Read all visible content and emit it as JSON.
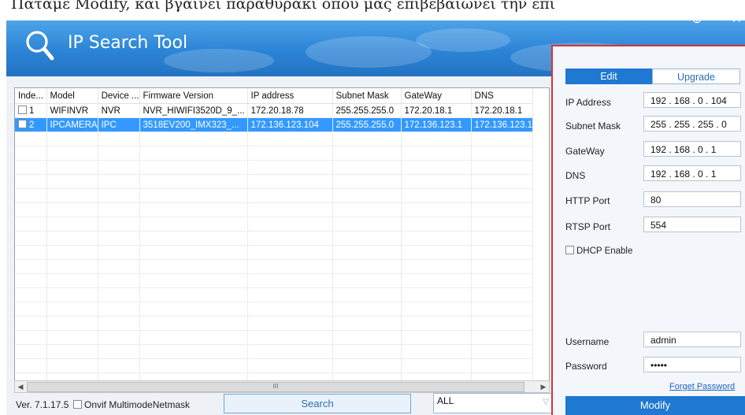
{
  "caption": "Πατάμε Modify, και βγαίνει παράθυράκι όπου μας επιβεβαιώνει την επι",
  "app": {
    "title": "IP Search Tool",
    "window_controls": {
      "add": "⊕",
      "minimize": "–",
      "close": "✕"
    }
  },
  "table": {
    "columns": [
      "Inde...",
      "Model",
      "Device ...",
      "Firmware Version",
      "IP address",
      "Subnet Mask",
      "GateWay",
      "DNS"
    ],
    "rows": [
      {
        "index": "1",
        "model": "WIFINVR",
        "device": "NVR",
        "firmware": "NVR_HIWIFI3520D_9_...",
        "ip": "172.20.18.78",
        "mask": "255.255.255.0",
        "gateway": "172.20.18.1",
        "dns": "172.20.18.1",
        "selected": false
      },
      {
        "index": "2",
        "model": "IPCAMERA",
        "device": "IPC",
        "firmware": "3518EV200_IMX323_...",
        "ip": "172.136.123.104",
        "mask": "255.255.255.0",
        "gateway": "172.136.123.1",
        "dns": "172.136.123.1",
        "selected": true
      }
    ],
    "scrollbar_thumb": "III"
  },
  "bottom": {
    "version": "Ver. 7.1.17.5",
    "onvif_label": "Onvif MultimodeNetmask",
    "search_label": "Search",
    "filter_value": "ALL"
  },
  "panel": {
    "tabs": {
      "edit": "Edit",
      "upgrade": "Upgrade"
    },
    "fields": {
      "ip_label": "IP Address",
      "ip_value": "192 . 168 .  0  . 104",
      "mask_label": "Subnet Mask",
      "mask_value": "255 . 255 . 255 .  0",
      "gateway_label": "GateWay",
      "gateway_value": "192 . 168 .  0  .  1",
      "dns_label": "DNS",
      "dns_value": "192 . 168 .  0  .  1",
      "http_label": "HTTP Port",
      "http_value": "80",
      "rtsp_label": "RTSP Port",
      "rtsp_value": "554",
      "dhcp_label": "DHCP Enable",
      "username_label": "Username",
      "username_value": "admin",
      "password_label": "Password",
      "password_value": "•••••"
    },
    "forget_label": "Forget Password",
    "modify_label": "Modify"
  }
}
